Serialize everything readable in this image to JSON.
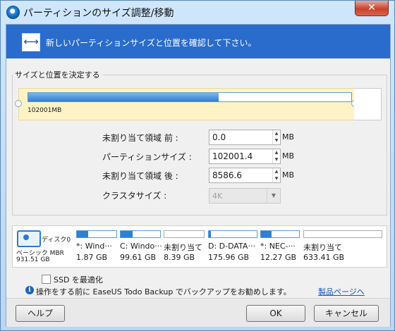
{
  "window": {
    "title": "パーティションのサイズ調整/移動",
    "close": "✕"
  },
  "banner": {
    "icon": "resize-arrows-icon",
    "text": "新しいパーティションサイズと位置を確認して下さい。"
  },
  "group": {
    "legend": "サイズと位置を決定する",
    "partition_size": "102001MB",
    "fill_fraction": 0.59
  },
  "fields": {
    "before_label": "未割り当て領域 前 :",
    "before_value": "0.0",
    "size_label": "パーティションサイズ :",
    "size_value": "102001.4",
    "after_label": "未割り当て領域 後 :",
    "after_value": "8586.6",
    "cluster_label": "クラスタサイズ :",
    "cluster_value": "4K",
    "unit": "MB"
  },
  "disk": {
    "icon": "disk-icon",
    "name": "ディスク0",
    "type": "ベーシック MBR",
    "size": "931.51 GB",
    "partitions": [
      {
        "name": "*: Wind···",
        "size": "1.87 GB",
        "fill": 0.28
      },
      {
        "name": "C: Windo···",
        "size": "99.61 GB",
        "fill": 0.3
      },
      {
        "name": "未割り当て",
        "size": "8.39 GB",
        "fill": 0
      },
      {
        "name": "D: D-DATA···",
        "size": "175.96 GB",
        "fill": 0.04
      },
      {
        "name": "*: NEC-···",
        "size": "12.27 GB",
        "fill": 0.28
      },
      {
        "name": "未割り当て",
        "size": "633.41 GB",
        "fill": 0
      }
    ]
  },
  "options": {
    "ssd": "SSD を最適化"
  },
  "info": {
    "icon": "info-icon",
    "text": "操作をする前に EaseUS Todo Backup でバックアップをお勧めします。",
    "link": "製品ページへ"
  },
  "buttons": {
    "help": "ヘルプ",
    "ok": "OK",
    "cancel": "キャンセル"
  }
}
